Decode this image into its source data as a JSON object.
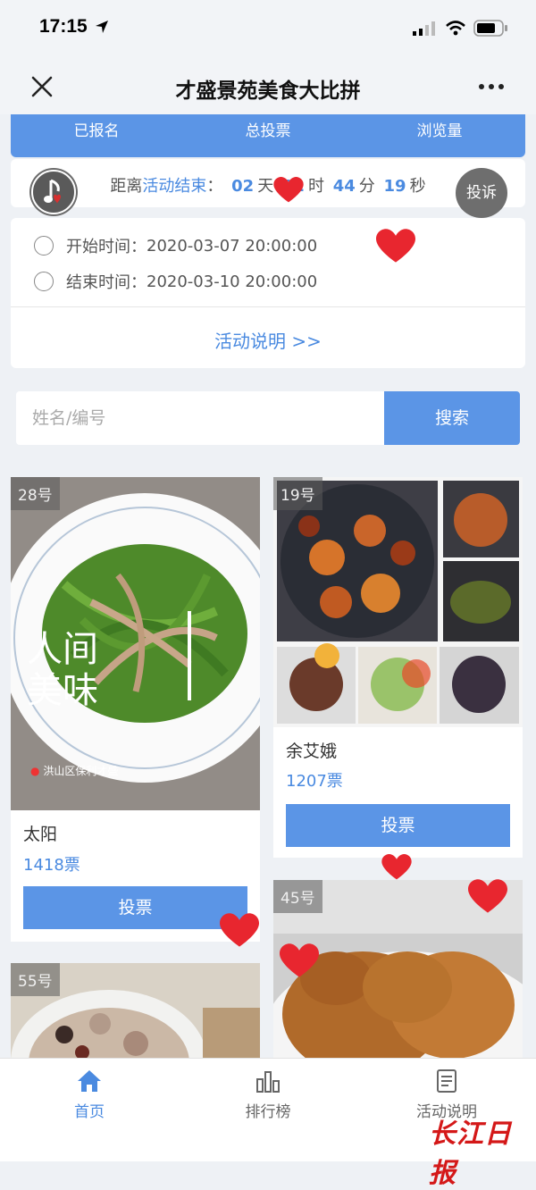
{
  "status_bar": {
    "time": "17:15"
  },
  "nav": {
    "title": "才盛景苑美食大比拼"
  },
  "stats": {
    "labels": [
      "已报名",
      "总投票",
      "浏览量"
    ]
  },
  "countdown": {
    "prefix": "距离",
    "highlight": "活动结束",
    "colon": "：",
    "days": "02",
    "days_unit": "天",
    "hours": "02",
    "hours_unit": "时",
    "minutes": "44",
    "minutes_unit": "分",
    "seconds": "19",
    "seconds_unit": "秒"
  },
  "complain_label": "投诉",
  "info": {
    "start_label": "开始时间：",
    "start_value": "2020-03-07 20:00:00",
    "end_label": "结束时间：",
    "end_value": "2020-03-10 20:00:00",
    "rules_link": "活动说明 >>"
  },
  "search": {
    "placeholder": "姓名/编号",
    "button": "搜索"
  },
  "entries": [
    {
      "number": "28号",
      "name": "太阳",
      "votes": "1418票",
      "vote_button": "投票",
      "photo_text_1": "人间",
      "photo_text_2": "美味",
      "photo_caption": "洪山区保利才盛"
    },
    {
      "number": "19号",
      "name": "余艾娥",
      "votes": "1207票",
      "vote_button": "投票"
    },
    {
      "number": "55号"
    },
    {
      "number": "45号"
    }
  ],
  "tabs": [
    {
      "label": "首页",
      "icon": "home-icon",
      "active": true
    },
    {
      "label": "排行榜",
      "icon": "bar-chart-icon",
      "active": false
    },
    {
      "label": "活动说明",
      "icon": "document-icon",
      "active": false
    }
  ],
  "watermark": "长江日报",
  "colors": {
    "accent": "#5b95e6",
    "accent_text": "#4a8ae0",
    "heart": "#e8262f"
  }
}
